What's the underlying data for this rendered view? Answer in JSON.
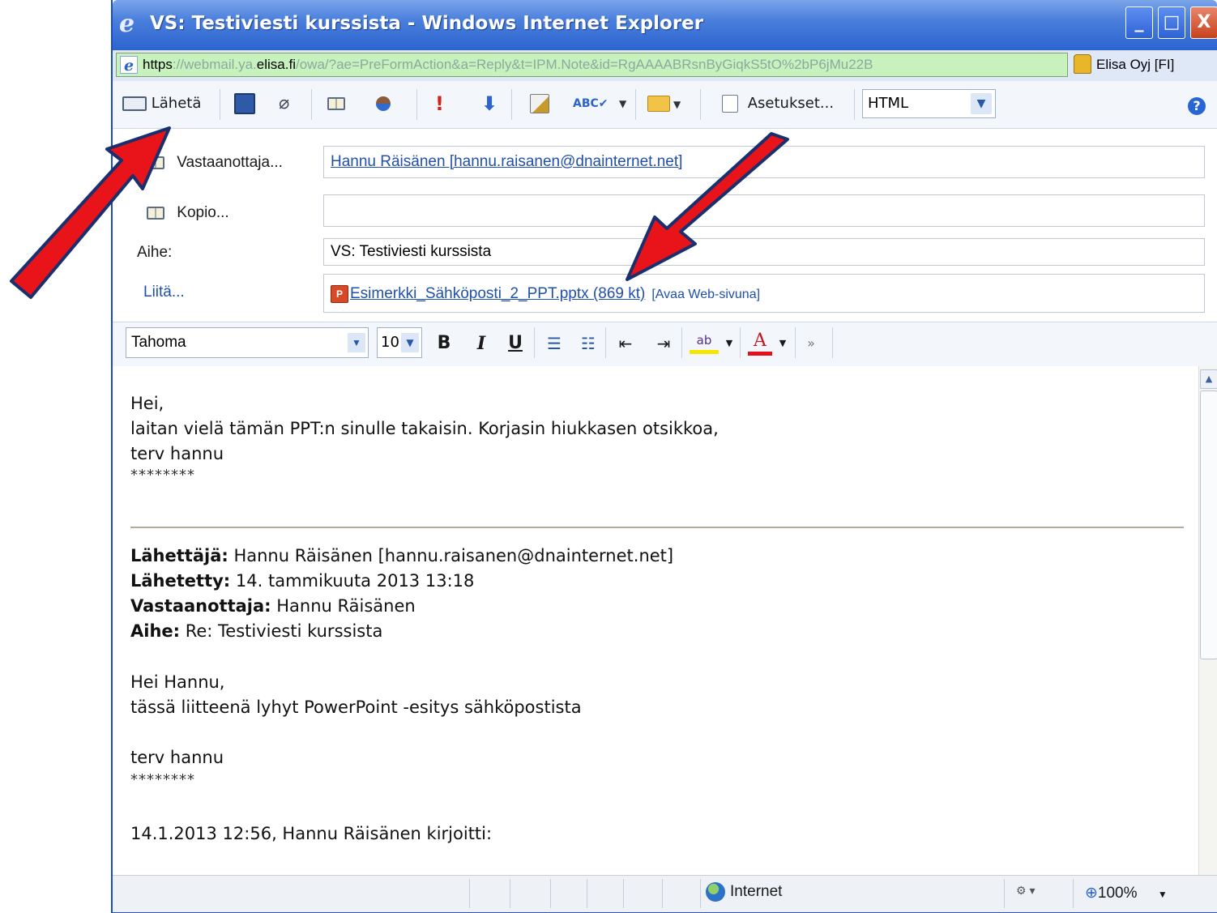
{
  "window": {
    "title": "VS: Testiviesti kurssista - Windows Internet Explorer",
    "controls": {
      "minimize": "_",
      "maximize": "□",
      "close": "X"
    }
  },
  "address": {
    "scheme": "https",
    "pre_host": "://webmail.ya.",
    "host": "elisa.fi",
    "path": "/owa/?ae=PreFormAction&a=Reply&t=IPM.Note&id=RgAAAABRsnByGiqkS5tO%2bP6jMu22B",
    "cert": "Elisa Oyj [FI]"
  },
  "toolbar": {
    "send_label": "Lähetä",
    "options_label": "Asetukset...",
    "format_value": "HTML"
  },
  "header": {
    "to_label": "Vastaanottaja...",
    "to_value": "Hannu Räisänen [hannu.raisanen@dnainternet.net]",
    "cc_label": "Kopio...",
    "cc_value": "",
    "subject_label": "Aihe:",
    "subject_value": "VS: Testiviesti kurssista",
    "attach_label": "Liitä...",
    "attachment_name": "Esimerkki_Sähköposti_2_PPT.pptx (869 kt)",
    "open_web": "[Avaa Web-sivuna]"
  },
  "format_bar": {
    "font": "Tahoma",
    "size": "10",
    "bold": "B",
    "italic": "I",
    "underline": "U"
  },
  "body": {
    "greeting": "Hei,",
    "line1": "laitan vielä tämän PPT:n sinulle takaisin. Korjasin hiukkasen otsikkoa,",
    "signoff": "terv hannu",
    "stars": "********",
    "from_key": "Lähettäjä:",
    "from_val": "Hannu Räisänen [hannu.raisanen@dnainternet.net]",
    "sent_key": "Lähetetty:",
    "sent_val": "14. tammikuuta 2013 13:18",
    "to_key": "Vastaanottaja:",
    "to_val": "Hannu Räisänen",
    "subj_key": "Aihe:",
    "subj_val": "Re: Testiviesti kurssista",
    "orig_greeting": "Hei Hannu,",
    "orig_line1": "tässä liitteenä lyhyt PowerPoint -esitys sähköpostista",
    "orig_signoff": "terv hannu",
    "orig_stars": "********",
    "quote_intro": "14.1.2013 12:56, Hannu Räisänen kirjoitti:"
  },
  "status": {
    "zone": "Internet",
    "zoom": "100%"
  },
  "colors": {
    "titlebar": "#2c64cf",
    "link": "#2150a8",
    "annotation_arrow": "#e8141a"
  }
}
